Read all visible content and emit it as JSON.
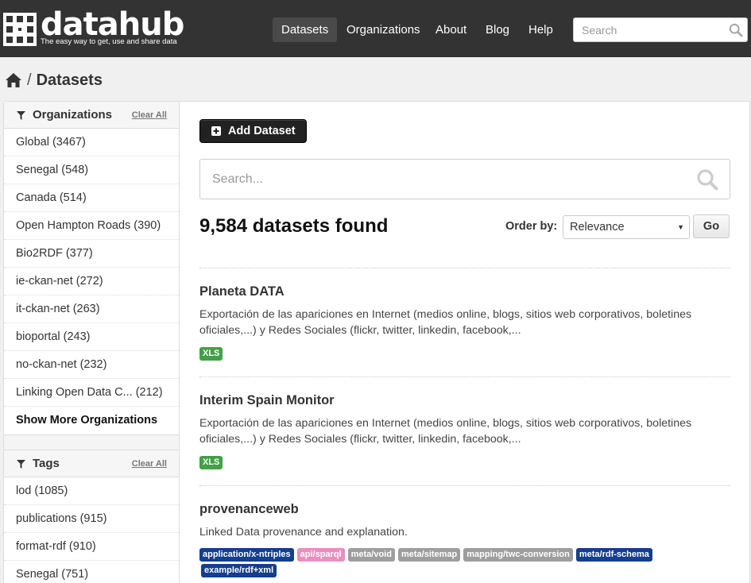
{
  "header": {
    "logo_text": "datahub",
    "logo_tagline": "The easy way to get, use and share data",
    "nav": [
      {
        "label": "Datasets",
        "active": true
      },
      {
        "label": "Organizations",
        "active": false
      },
      {
        "label": "About",
        "active": false
      },
      {
        "label": "Blog",
        "active": false
      },
      {
        "label": "Help",
        "active": false
      }
    ],
    "search_placeholder": "Search"
  },
  "breadcrumb": {
    "separator": "/",
    "current": "Datasets"
  },
  "sidebar": {
    "organizations": {
      "title": "Organizations",
      "clear_label": "Clear All",
      "items": [
        "Global (3467)",
        "Senegal (548)",
        "Canada (514)",
        "Open Hampton Roads (390)",
        "Bio2RDF (377)",
        "ie-ckan-net (272)",
        "it-ckan-net (263)",
        "bioportal (243)",
        "no-ckan-net (232)",
        "Linking Open Data C... (212)"
      ],
      "show_more": "Show More Organizations"
    },
    "tags": {
      "title": "Tags",
      "clear_label": "Clear All",
      "items": [
        "lod (1085)",
        "publications (915)",
        "format-rdf (910)",
        "Senegal (751)"
      ]
    }
  },
  "main": {
    "add_button": "Add Dataset",
    "search_placeholder": "Search...",
    "count_text": "9,584 datasets found",
    "order_label": "Order by:",
    "order_value": "Relevance",
    "go_label": "Go",
    "datasets": [
      {
        "title": "Planeta DATA",
        "description": "Exportación de las apariciones en Internet (medios online, blogs, sitios web corporativos, boletines oficiales,...) y Redes Sociales (flickr, twitter, linkedin, facebook,...",
        "formats": [
          {
            "label": "XLS",
            "color": "#43a047"
          }
        ]
      },
      {
        "title": "Interim Spain Monitor",
        "description": "Exportación de las apariciones en Internet (medios online, blogs, sitios web corporativos, boletines oficiales,...) y Redes Sociales (flickr, twitter, linkedin, facebook,...",
        "formats": [
          {
            "label": "XLS",
            "color": "#43a047"
          }
        ]
      },
      {
        "title": "provenanceweb",
        "description": "Linked Data provenance and explanation.",
        "formats": [
          {
            "label": "application/x-ntriples",
            "color": "#153e8c"
          },
          {
            "label": "api/sparql",
            "color": "#e88fc0"
          },
          {
            "label": "meta/void",
            "color": "#9e9e9e"
          },
          {
            "label": "meta/sitemap",
            "color": "#9e9e9e"
          },
          {
            "label": "mapping/twc-conversion",
            "color": "#9e9e9e"
          },
          {
            "label": "meta/rdf-schema",
            "color": "#153e8c"
          },
          {
            "label": "example/rdf+xml",
            "color": "#153e8c"
          }
        ]
      }
    ]
  },
  "colors": {
    "header_bg": "#333333",
    "page_bg": "#f0f0f0",
    "primary_button": "#222222"
  }
}
